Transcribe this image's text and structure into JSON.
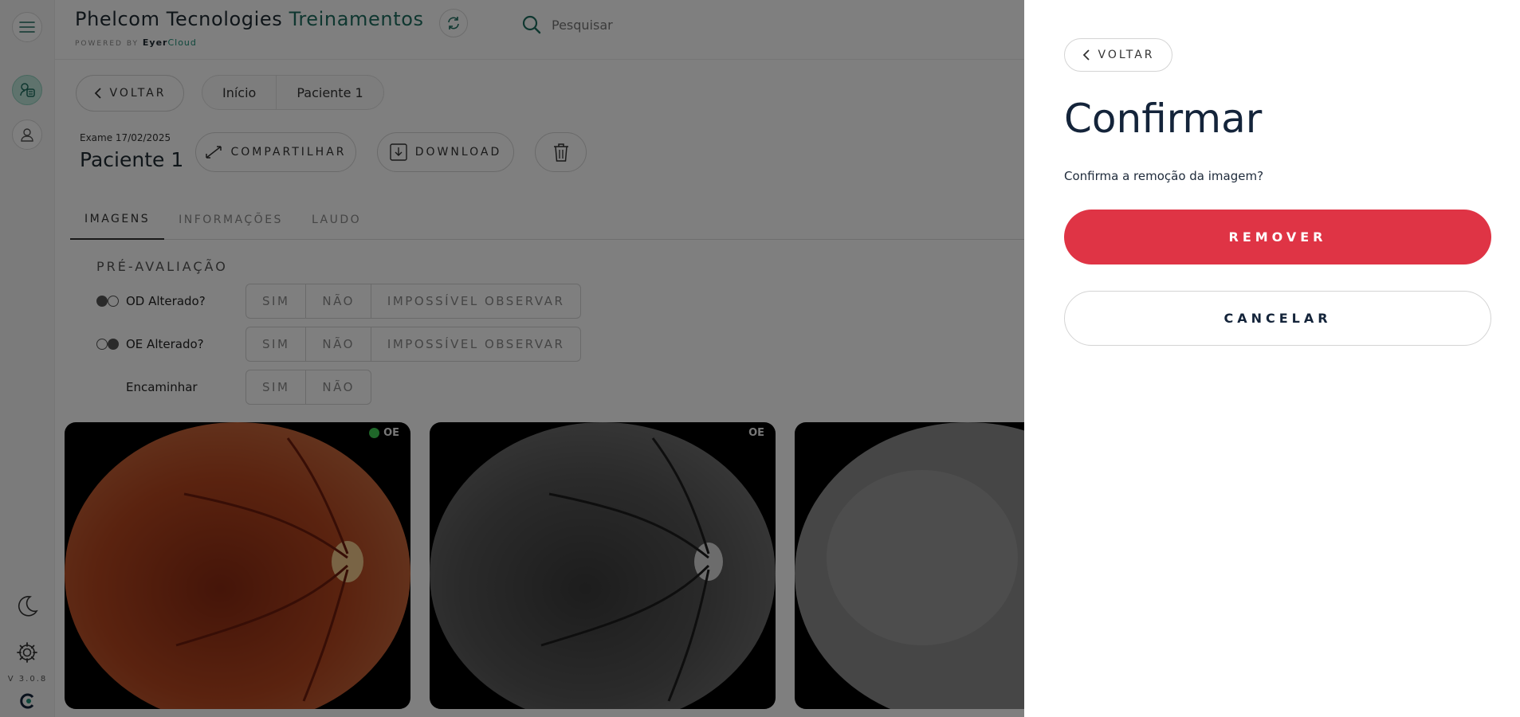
{
  "app": {
    "title_main": "Phelcom Tecnologies",
    "title_accent": "Treinamentos",
    "powered_prefix": "POWERED BY",
    "powered_brand": "Eyer",
    "powered_cloud": "Cloud",
    "version": "V 3.0.8"
  },
  "header": {
    "search_placeholder": "Pesquisar"
  },
  "page": {
    "back_label": "VOLTAR",
    "breadcrumb": [
      "Início",
      "Paciente 1"
    ],
    "exam_date": "Exame 17/02/2025",
    "patient_name": "Paciente 1",
    "share_label": "COMPARTILHAR",
    "download_label": "DOWNLOAD",
    "tabs": [
      "IMAGENS",
      "INFORMAÇÕES",
      "LAUDO"
    ],
    "pre_eval_title": "PRÉ-AVALIAÇÃO",
    "questions": [
      {
        "label": "OD Alterado?",
        "options": [
          "SIM",
          "NÃO",
          "IMPOSSÍVEL OBSERVAR"
        ]
      },
      {
        "label": "OE Alterado?",
        "options": [
          "SIM",
          "NÃO",
          "IMPOSSÍVEL OBSERVAR"
        ]
      },
      {
        "label": "Encaminhar",
        "options": [
          "SIM",
          "NÃO"
        ]
      }
    ],
    "images": [
      {
        "eye": "OE",
        "selected": true
      },
      {
        "eye": "OE",
        "selected": false
      },
      {
        "eye": "",
        "selected": false
      }
    ]
  },
  "dialog": {
    "back_label": "VOLTAR",
    "title": "Confirmar",
    "message": "Confirma a remoção da imagem?",
    "confirm_label": "REMOVER",
    "cancel_label": "CANCELAR"
  },
  "colors": {
    "brand_green": "#1f6f60",
    "danger": "#df3445",
    "title_navy": "#14243a",
    "overlay": "rgba(0,0,0,0.5)"
  }
}
